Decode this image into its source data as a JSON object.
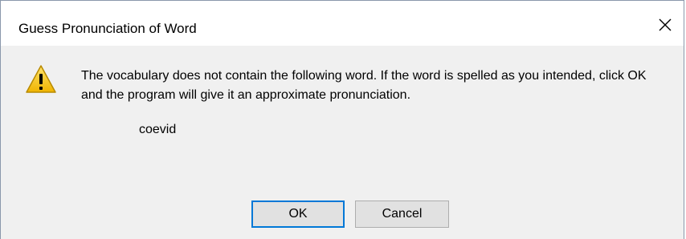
{
  "dialog": {
    "title": "Guess Pronunciation of Word",
    "message": "The vocabulary does not contain the following word. If the word is spelled as you intended, click OK and the program will give it an approximate pronunciation.",
    "word": "coevid",
    "icon": "warning-icon",
    "close_icon": "close-icon",
    "buttons": {
      "ok_label": "OK",
      "cancel_label": "Cancel"
    }
  },
  "colors": {
    "accent": "#0078d7",
    "warning_yellow": "#f5c518",
    "dialog_background": "#f0f0f0"
  }
}
